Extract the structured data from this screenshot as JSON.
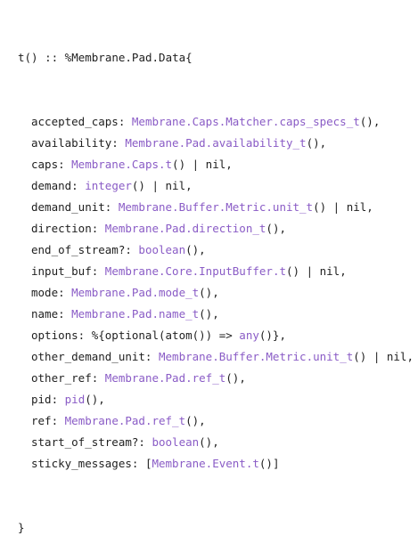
{
  "spec": {
    "header": "t() :: %Membrane.Pad.Data{",
    "fields": [
      {
        "key": "accepted_caps: ",
        "type": "Membrane.Caps.Matcher.caps_specs_t",
        "post": "(),",
        "prefix": ""
      },
      {
        "key": "availability: ",
        "type": "Membrane.Pad.availability_t",
        "post": "(),",
        "prefix": ""
      },
      {
        "key": "caps: ",
        "type": "Membrane.Caps.t",
        "post": "() | nil,",
        "prefix": ""
      },
      {
        "key": "demand: ",
        "type": "integer",
        "post": "() | nil,",
        "prefix": ""
      },
      {
        "key": "demand_unit: ",
        "type": "Membrane.Buffer.Metric.unit_t",
        "post": "() | nil,",
        "prefix": ""
      },
      {
        "key": "direction: ",
        "type": "Membrane.Pad.direction_t",
        "post": "(),",
        "prefix": ""
      },
      {
        "key": "end_of_stream?: ",
        "type": "boolean",
        "post": "(),",
        "prefix": ""
      },
      {
        "key": "input_buf: ",
        "type": "Membrane.Core.InputBuffer.t",
        "post": "() | nil,",
        "prefix": ""
      },
      {
        "key": "mode: ",
        "type": "Membrane.Pad.mode_t",
        "post": "(),",
        "prefix": ""
      },
      {
        "key": "name: ",
        "type": "Membrane.Pad.name_t",
        "post": "(),",
        "prefix": ""
      },
      {
        "key": "options: %{optional(atom()) => ",
        "type": "any",
        "post": "()},",
        "prefix": ""
      },
      {
        "key": "other_demand_unit: ",
        "type": "Membrane.Buffer.Metric.unit_t",
        "post": "() | nil,",
        "prefix": ""
      },
      {
        "key": "other_ref: ",
        "type": "Membrane.Pad.ref_t",
        "post": "(),",
        "prefix": ""
      },
      {
        "key": "pid: ",
        "type": "pid",
        "post": "(),",
        "prefix": ""
      },
      {
        "key": "ref: ",
        "type": "Membrane.Pad.ref_t",
        "post": "(),",
        "prefix": ""
      },
      {
        "key": "start_of_stream?: ",
        "type": "boolean",
        "post": "(),",
        "prefix": ""
      },
      {
        "key": "sticky_messages: ",
        "type": "Membrane.Event.t",
        "post": "()]",
        "prefix": "["
      }
    ],
    "footer": "}"
  },
  "colors": {
    "text": "#1f1f1f",
    "type_link": "#8a5cc6",
    "background": "#ffffff"
  }
}
